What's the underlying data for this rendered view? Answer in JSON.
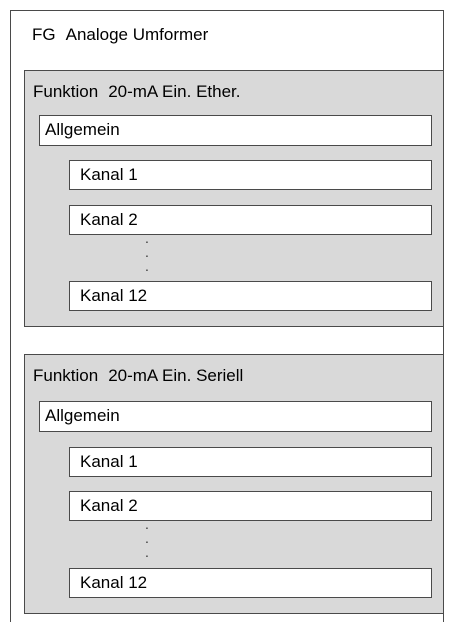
{
  "outer": {
    "prefix": "FG",
    "name": "Analoge Umformer"
  },
  "groups": [
    {
      "prefix": "Funktion",
      "name": "20-mA Ein. Ether.",
      "general": "Allgemein",
      "channels": [
        "Kanal 1",
        "Kanal 2",
        "Kanal 12"
      ],
      "ellipsis": "."
    },
    {
      "prefix": "Funktion",
      "name": "20-mA Ein. Seriell",
      "general": "Allgemein",
      "channels": [
        "Kanal 1",
        "Kanal 2",
        "Kanal 12"
      ],
      "ellipsis": "."
    }
  ]
}
